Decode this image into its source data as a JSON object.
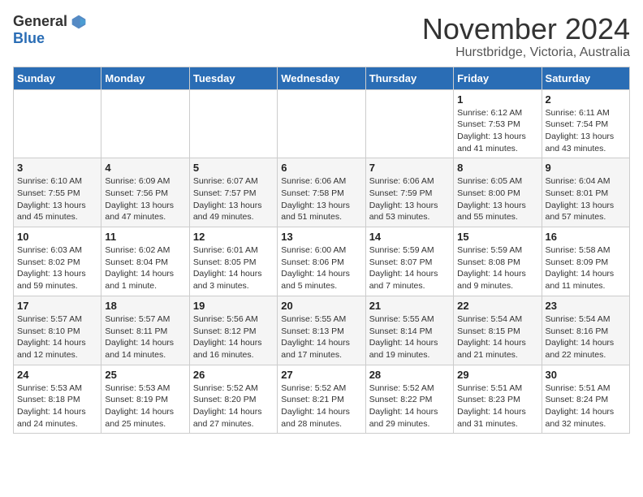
{
  "header": {
    "logo_general": "General",
    "logo_blue": "Blue",
    "month_title": "November 2024",
    "subtitle": "Hurstbridge, Victoria, Australia"
  },
  "weekdays": [
    "Sunday",
    "Monday",
    "Tuesday",
    "Wednesday",
    "Thursday",
    "Friday",
    "Saturday"
  ],
  "weeks": [
    [
      {
        "day": "",
        "info": ""
      },
      {
        "day": "",
        "info": ""
      },
      {
        "day": "",
        "info": ""
      },
      {
        "day": "",
        "info": ""
      },
      {
        "day": "",
        "info": ""
      },
      {
        "day": "1",
        "info": "Sunrise: 6:12 AM\nSunset: 7:53 PM\nDaylight: 13 hours\nand 41 minutes."
      },
      {
        "day": "2",
        "info": "Sunrise: 6:11 AM\nSunset: 7:54 PM\nDaylight: 13 hours\nand 43 minutes."
      }
    ],
    [
      {
        "day": "3",
        "info": "Sunrise: 6:10 AM\nSunset: 7:55 PM\nDaylight: 13 hours\nand 45 minutes."
      },
      {
        "day": "4",
        "info": "Sunrise: 6:09 AM\nSunset: 7:56 PM\nDaylight: 13 hours\nand 47 minutes."
      },
      {
        "day": "5",
        "info": "Sunrise: 6:07 AM\nSunset: 7:57 PM\nDaylight: 13 hours\nand 49 minutes."
      },
      {
        "day": "6",
        "info": "Sunrise: 6:06 AM\nSunset: 7:58 PM\nDaylight: 13 hours\nand 51 minutes."
      },
      {
        "day": "7",
        "info": "Sunrise: 6:06 AM\nSunset: 7:59 PM\nDaylight: 13 hours\nand 53 minutes."
      },
      {
        "day": "8",
        "info": "Sunrise: 6:05 AM\nSunset: 8:00 PM\nDaylight: 13 hours\nand 55 minutes."
      },
      {
        "day": "9",
        "info": "Sunrise: 6:04 AM\nSunset: 8:01 PM\nDaylight: 13 hours\nand 57 minutes."
      }
    ],
    [
      {
        "day": "10",
        "info": "Sunrise: 6:03 AM\nSunset: 8:02 PM\nDaylight: 13 hours\nand 59 minutes."
      },
      {
        "day": "11",
        "info": "Sunrise: 6:02 AM\nSunset: 8:04 PM\nDaylight: 14 hours\nand 1 minute."
      },
      {
        "day": "12",
        "info": "Sunrise: 6:01 AM\nSunset: 8:05 PM\nDaylight: 14 hours\nand 3 minutes."
      },
      {
        "day": "13",
        "info": "Sunrise: 6:00 AM\nSunset: 8:06 PM\nDaylight: 14 hours\nand 5 minutes."
      },
      {
        "day": "14",
        "info": "Sunrise: 5:59 AM\nSunset: 8:07 PM\nDaylight: 14 hours\nand 7 minutes."
      },
      {
        "day": "15",
        "info": "Sunrise: 5:59 AM\nSunset: 8:08 PM\nDaylight: 14 hours\nand 9 minutes."
      },
      {
        "day": "16",
        "info": "Sunrise: 5:58 AM\nSunset: 8:09 PM\nDaylight: 14 hours\nand 11 minutes."
      }
    ],
    [
      {
        "day": "17",
        "info": "Sunrise: 5:57 AM\nSunset: 8:10 PM\nDaylight: 14 hours\nand 12 minutes."
      },
      {
        "day": "18",
        "info": "Sunrise: 5:57 AM\nSunset: 8:11 PM\nDaylight: 14 hours\nand 14 minutes."
      },
      {
        "day": "19",
        "info": "Sunrise: 5:56 AM\nSunset: 8:12 PM\nDaylight: 14 hours\nand 16 minutes."
      },
      {
        "day": "20",
        "info": "Sunrise: 5:55 AM\nSunset: 8:13 PM\nDaylight: 14 hours\nand 17 minutes."
      },
      {
        "day": "21",
        "info": "Sunrise: 5:55 AM\nSunset: 8:14 PM\nDaylight: 14 hours\nand 19 minutes."
      },
      {
        "day": "22",
        "info": "Sunrise: 5:54 AM\nSunset: 8:15 PM\nDaylight: 14 hours\nand 21 minutes."
      },
      {
        "day": "23",
        "info": "Sunrise: 5:54 AM\nSunset: 8:16 PM\nDaylight: 14 hours\nand 22 minutes."
      }
    ],
    [
      {
        "day": "24",
        "info": "Sunrise: 5:53 AM\nSunset: 8:18 PM\nDaylight: 14 hours\nand 24 minutes."
      },
      {
        "day": "25",
        "info": "Sunrise: 5:53 AM\nSunset: 8:19 PM\nDaylight: 14 hours\nand 25 minutes."
      },
      {
        "day": "26",
        "info": "Sunrise: 5:52 AM\nSunset: 8:20 PM\nDaylight: 14 hours\nand 27 minutes."
      },
      {
        "day": "27",
        "info": "Sunrise: 5:52 AM\nSunset: 8:21 PM\nDaylight: 14 hours\nand 28 minutes."
      },
      {
        "day": "28",
        "info": "Sunrise: 5:52 AM\nSunset: 8:22 PM\nDaylight: 14 hours\nand 29 minutes."
      },
      {
        "day": "29",
        "info": "Sunrise: 5:51 AM\nSunset: 8:23 PM\nDaylight: 14 hours\nand 31 minutes."
      },
      {
        "day": "30",
        "info": "Sunrise: 5:51 AM\nSunset: 8:24 PM\nDaylight: 14 hours\nand 32 minutes."
      }
    ]
  ]
}
